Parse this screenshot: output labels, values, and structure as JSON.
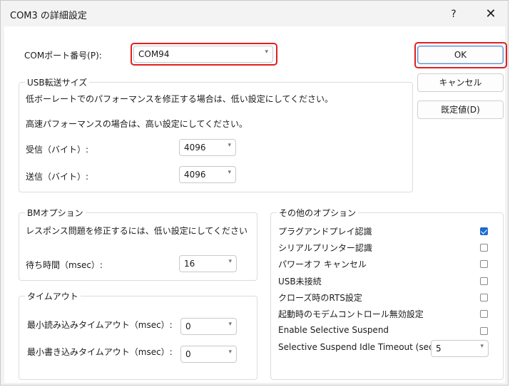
{
  "dialog": {
    "title": "COM3 の詳細設定",
    "help": "?",
    "close": "✕"
  },
  "port": {
    "label": "COMポート番号(P):",
    "value": "COM94"
  },
  "buttons": {
    "ok": "OK",
    "cancel": "キャンセル",
    "defaults": "既定値(D)"
  },
  "usb": {
    "title": "USB転送サイズ",
    "note1": "低ボーレートでのパフォーマンスを修正する場合は、低い設定にしてください。",
    "note2": "高速パフォーマンスの場合は、高い設定にしてください。",
    "receive_label": "受信（バイト）:",
    "receive_value": "4096",
    "send_label": "送信（バイト）:",
    "send_value": "4096"
  },
  "bm": {
    "title": "BMオプション",
    "note": "レスポンス問題を修正するには、低い設定にしてください",
    "latency_label": "待ち時間（msec）:",
    "latency_value": "16"
  },
  "timeout": {
    "title": "タイムアウト",
    "read_label": "最小読み込みタイムアウト（msec）:",
    "read_value": "0",
    "write_label": "最小書き込みタイムアウト（msec）:",
    "write_value": "0"
  },
  "other": {
    "title": "その他のオプション",
    "options": [
      {
        "label": "プラグアンドプレイ認識",
        "checked": true
      },
      {
        "label": "シリアルプリンター認識",
        "checked": false
      },
      {
        "label": "パワーオフ キャンセル",
        "checked": false
      },
      {
        "label": "USB未接続",
        "checked": false
      },
      {
        "label": "クローズ時のRTS設定",
        "checked": false
      },
      {
        "label": "起動時のモデムコントロール無効設定",
        "checked": false
      },
      {
        "label": "Enable Selective Suspend",
        "checked": false
      }
    ],
    "idle_label": "Selective Suspend Idle Timeout (secs):",
    "idle_value": "5"
  },
  "colors": {
    "highlight": "#e02020",
    "checkbox_checked": "#1d6bd1"
  }
}
